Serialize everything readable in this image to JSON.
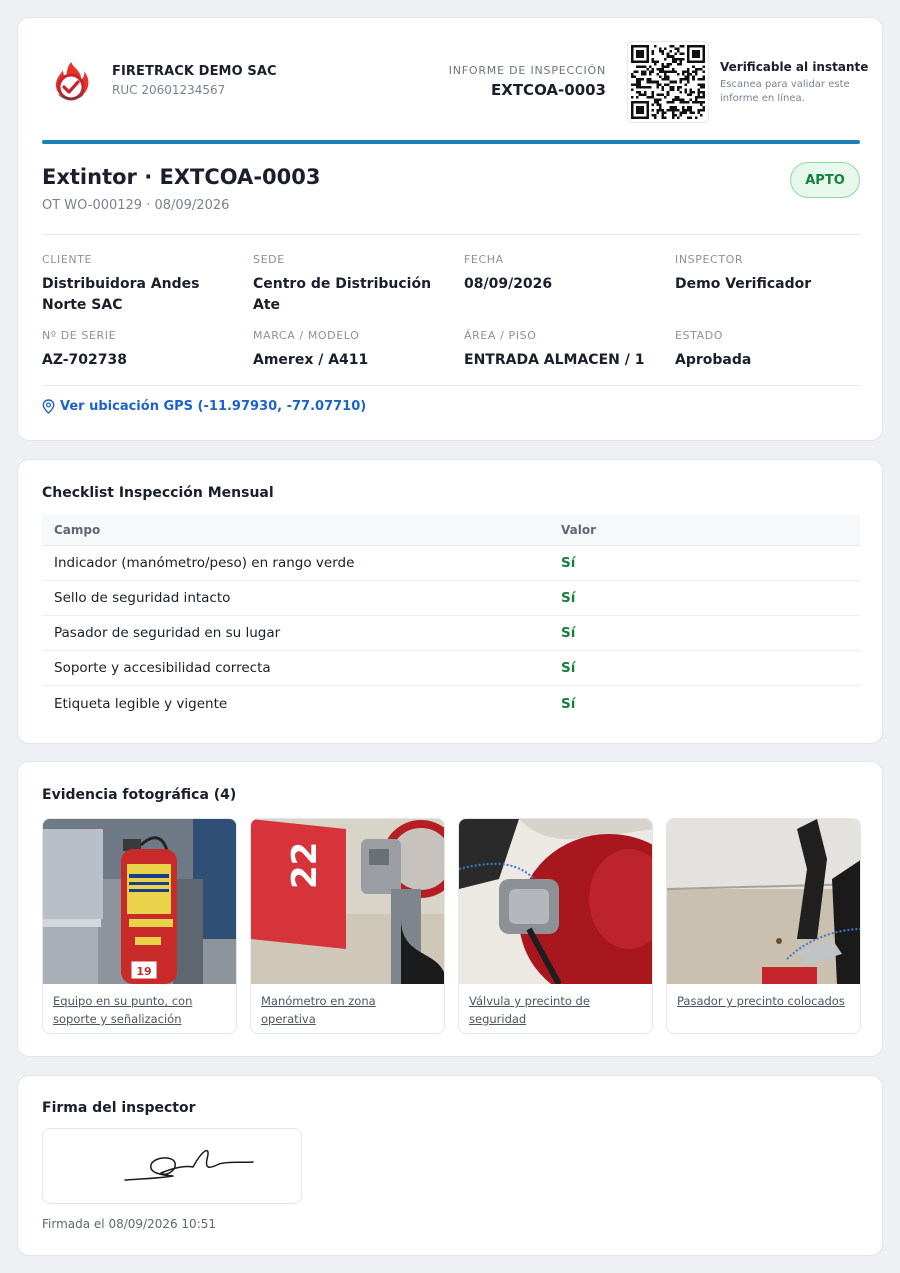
{
  "header": {
    "company_name": "FIRETRACK DEMO SAC",
    "company_ruc": "RUC 20601234567",
    "report_label": "INFORME DE INSPECCIÓN",
    "report_code": "EXTCOA-0003",
    "verify_title": "Verificable al instante",
    "verify_subtitle": "Escanea para validar este informe en línea.",
    "accent_color": "#1c7fb6"
  },
  "equipment": {
    "title": "Extintor · EXTCOA-0003",
    "subtitle": "OT WO-000129 · 08/09/2026",
    "status": "APTO",
    "status_color": "#17803d"
  },
  "fields": [
    {
      "label": "CLIENTE",
      "value": "Distribuidora Andes Norte SAC"
    },
    {
      "label": "SEDE",
      "value": "Centro de Distribución Ate"
    },
    {
      "label": "FECHA",
      "value": "08/09/2026"
    },
    {
      "label": "INSPECTOR",
      "value": "Demo Verificador"
    },
    {
      "label": "Nº DE SERIE",
      "value": "AZ-702738"
    },
    {
      "label": "MARCA / MODELO",
      "value": "Amerex / A411"
    },
    {
      "label": "ÁREA / PISO",
      "value": "ENTRADA ALMACEN / 1"
    },
    {
      "label": "ESTADO",
      "value": "Aprobada"
    }
  ],
  "gps": {
    "label": "Ver ubicación GPS (-11.97930, -77.07710)",
    "icon": "map-pin-icon"
  },
  "checklist": {
    "title": "Checklist Inspección Mensual",
    "columns": [
      "Campo",
      "Valor"
    ],
    "rows": [
      {
        "campo": "Indicador (manómetro/peso) en rango verde",
        "valor": "Sí"
      },
      {
        "campo": "Sello de seguridad intacto",
        "valor": "Sí"
      },
      {
        "campo": "Pasador de seguridad en su lugar",
        "valor": "Sí"
      },
      {
        "campo": "Soporte y accesibilidad correcta",
        "valor": "Sí"
      },
      {
        "campo": "Etiqueta legible y vigente",
        "valor": "Sí"
      }
    ]
  },
  "photos": {
    "title": "Evidencia fotográfica (4)",
    "items": [
      {
        "caption": "Equipo en su punto, con soporte y señalización",
        "tag": "19"
      },
      {
        "caption": "Manómetro en zona operativa",
        "tag": "22"
      },
      {
        "caption": "Válvula y precinto de seguridad"
      },
      {
        "caption": "Pasador y precinto colocados"
      }
    ]
  },
  "signature": {
    "title": "Firma del inspector",
    "signed_at": "Firmada el 08/09/2026 10:51"
  }
}
